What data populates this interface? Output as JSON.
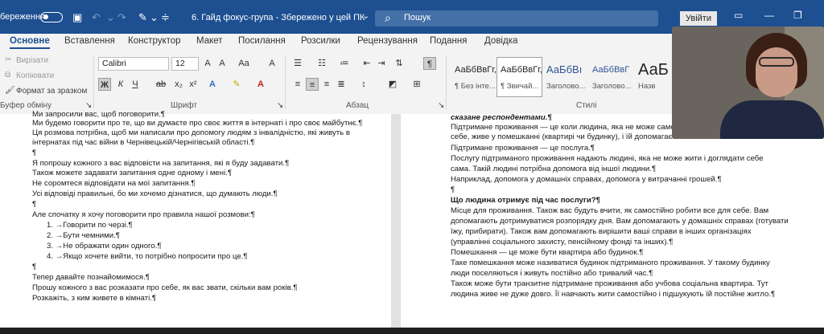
{
  "title_bar": {
    "autosave_label": "береження",
    "doc_title": "6. Гайд фокус-група  -  Збережено у цей ПК",
    "title_chevron": "⌄",
    "search_placeholder": "Пошук",
    "signin_label": "Увійти"
  },
  "tabs": [
    "Основне",
    "Вставлення",
    "Конструктор",
    "Макет",
    "Посилання",
    "Розсилки",
    "Рецензування",
    "Подання",
    "Довідка"
  ],
  "ribbon": {
    "clipboard": {
      "cut": "Вирізати",
      "copy": "Копіювати",
      "format_painter": "Формат за зразком",
      "label": "Буфер обміну"
    },
    "font": {
      "family": "Calibri",
      "size": "12",
      "label": "Шрифт"
    },
    "paragraph": {
      "label": "Абзац"
    },
    "styles": {
      "label": "Стилі",
      "items": [
        {
          "sample": "АаБбВвГг,",
          "name": "¶ Без інте..."
        },
        {
          "sample": "АаБбВвГг,",
          "name": "¶ Звичай..."
        },
        {
          "sample": "АаБбВı",
          "name": "Заголово..."
        },
        {
          "sample": "АаБбВвГ",
          "name": "Заголово..."
        },
        {
          "sample": "АаБ",
          "name": "Назв"
        }
      ]
    }
  },
  "doc_left": [
    "Ми запросили вас, щоб поговорити.¶",
    "Ми будемо говорити про те, що ви думаєте про своє життя в інтернаті і про своє майбутнє.¶",
    "Ця розмова потрібна, щоб ми написали про допомогу людям з інвалідністю, які живуть в",
    "інтернатах під час війни в Чернівецькій/Чернігівській області.¶",
    "¶",
    "Я попрошу кожного з вас відповісти на запитання, які я буду задавати.¶",
    "Також можете задавати запитання одне одному і мені.¶",
    "Не соромтеся відповідати на мої запитання.¶",
    "Усі відповіді правильні, бо ми хочемо дізнатися, що думають люди.¶",
    "¶",
    "Але спочатку я хочу поговорити про правила нашої розмови:¶",
    "1. →Говорити по черзі.¶",
    "2. →Бути чемними.¶",
    "3. →Не ображати один одного.¶",
    "4. →Якщо хочете вийти, то потрібно попросити про це.¶",
    "¶",
    "Тепер давайте познайомимося.¶",
    "Прошу кожного з вас розказати про себе, як вас звати, скільки вам років.¶",
    "Розкажіть, з ким живете в кімнаті.¶"
  ],
  "doc_right": [
    "сказане респондентами.¶",
    "Підтримане проживання — це коли людина, яка не може само",
    "себе, живе у помешканні (квартирі чи будинку), і їй допомагає",
    "Підтримане проживання — це послуга.¶",
    "Послугу підтриманого проживання надають людині, яка не може жити і доглядати себе",
    "сама. Такій людині потрібна допомога від іншої людини.¶",
    "Наприклад, допомога у домашніх справах, допомога у витрачанні грошей.¶",
    "¶",
    "Що людина отримує під час послуги?¶",
    "Місце для проживання. Також вас будуть вчити, як самостійно робити все для себе. Вам",
    "допомагають дотримуватися розпорядку дня. Вам допомагають у домашніх справах (готувати",
    "їжу, прибирати). Також вам допомагають вирішити ваші справи в інших організаціях",
    "(управлінні соціального захисту, пенсійному фонді та інших).¶",
    "Помешкання — це може бути квартира або будинок.¶",
    "Таке помешкання може називатися будинок підтриманого проживання. У такому будинку",
    "люди поселяються і живуть постійно або тривалий час.¶",
    "Також може бути транзитне підтримане проживання або учбова соціальна квартира. Тут",
    "людина живе не дуже довго. Її навчають жити самостійно і підшукують їй постійне житло.¶"
  ]
}
